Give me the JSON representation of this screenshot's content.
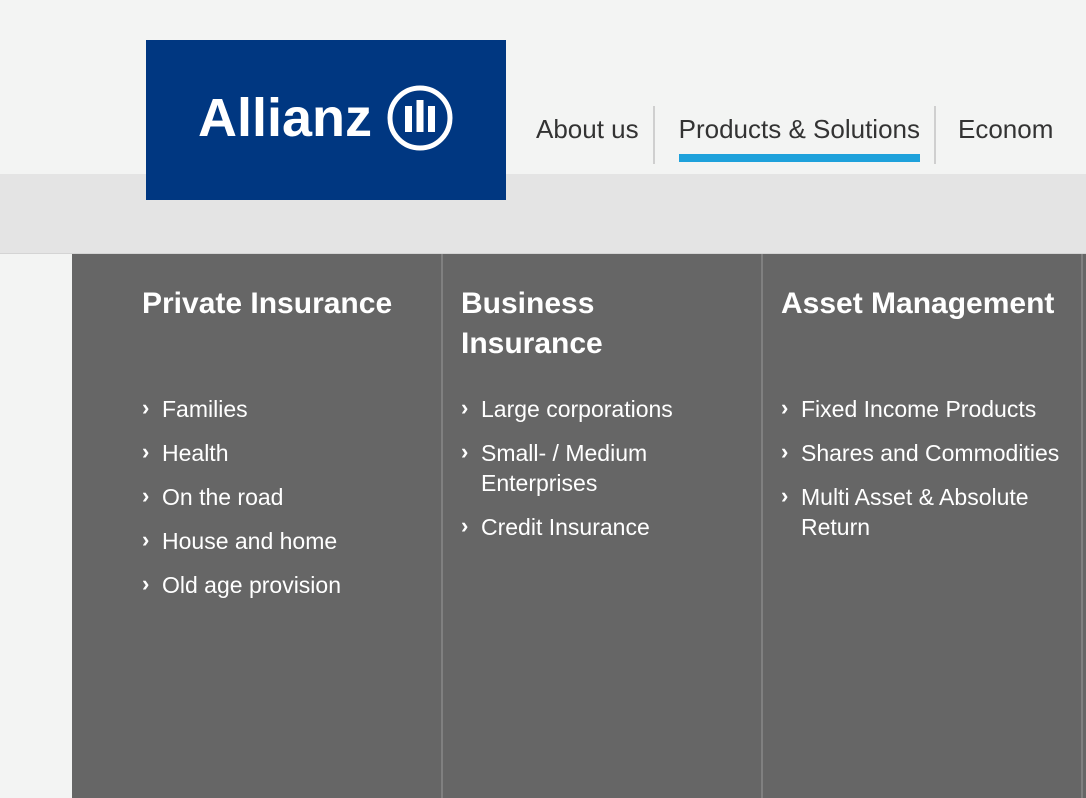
{
  "brand": {
    "name": "Allianz",
    "bg_color": "#003781"
  },
  "top_nav": {
    "items": [
      {
        "label": "About us",
        "active": false
      },
      {
        "label": "Products & Solutions",
        "active": true
      },
      {
        "label": "Econom",
        "active": false
      }
    ],
    "active_color": "#1ea1db"
  },
  "mega_menu": {
    "bg_color": "#666666",
    "columns": [
      {
        "title": "Private Insurance",
        "links": [
          "Families",
          "Health",
          "On the road",
          "House and home",
          "Old age provision"
        ]
      },
      {
        "title": "Business Insurance",
        "links": [
          "Large corporations",
          "Small- / Medium Enterprises",
          "Credit Insurance"
        ]
      },
      {
        "title": "Asset Management",
        "links": [
          "Fixed Income Products",
          "Shares and Commodities",
          "Multi Asset & Absolute Return"
        ]
      }
    ],
    "chevron_icon": "›"
  }
}
